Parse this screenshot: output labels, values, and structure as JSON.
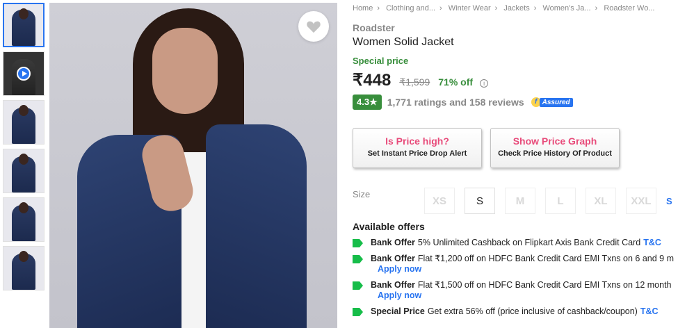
{
  "breadcrumb": [
    "Home",
    "Clothing and...",
    "Winter Wear",
    "Jackets",
    "Women's Ja...",
    "Roadster Wo..."
  ],
  "product": {
    "brand": "Roadster",
    "title": "Women Solid Jacket",
    "special_label": "Special price",
    "price": "₹448",
    "mrp": "₹1,599",
    "discount": "71% off",
    "rating": "4.3★",
    "ratings_text": "1,771 ratings and 158 reviews",
    "assured_label": "Assured"
  },
  "cards": [
    {
      "heading": "Is Price high?",
      "sub": "Set Instant Price Drop Alert"
    },
    {
      "heading": "Show Price Graph",
      "sub": "Check Price History Of Product"
    }
  ],
  "size": {
    "label": "Size",
    "options": [
      "XS",
      "S",
      "M",
      "L",
      "XL",
      "XXL"
    ],
    "available": "S",
    "more": "S"
  },
  "offers": {
    "title": "Available offers",
    "items": [
      {
        "type": "Bank Offer",
        "text": "5% Unlimited Cashback on Flipkart Axis Bank Credit Card",
        "tc": "T&C",
        "apply": ""
      },
      {
        "type": "Bank Offer",
        "text": "Flat ₹1,200 off on HDFC Bank Credit Card EMI Txns on 6 and 9 m",
        "tc": "",
        "apply": "Apply now"
      },
      {
        "type": "Bank Offer",
        "text": "Flat ₹1,500 off on HDFC Bank Credit Card EMI Txns on 12 month",
        "tc": "",
        "apply": "Apply now"
      },
      {
        "type": "Special Price",
        "text": "Get extra 56% off (price inclusive of cashback/coupon)",
        "tc": "T&C",
        "apply": ""
      }
    ]
  },
  "colors": {
    "accent": "#2874f0",
    "green": "#388e3c",
    "pink": "#e84b7a"
  }
}
